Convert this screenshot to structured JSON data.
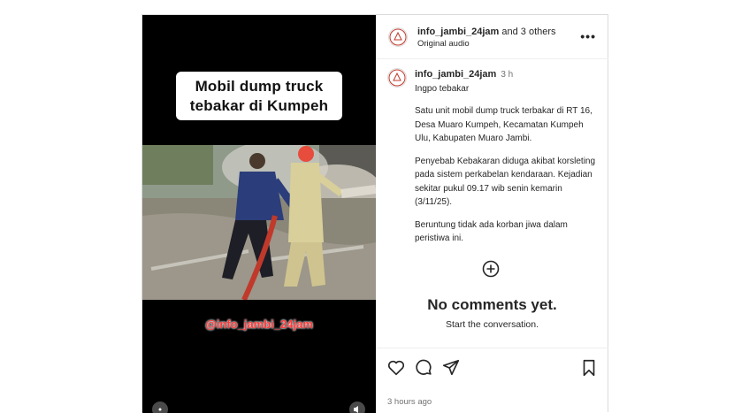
{
  "media": {
    "title_line1": "Mobil dump truck",
    "title_line2": "tebakar di Kumpeh",
    "watermark": "@info_jambi_24jam"
  },
  "header": {
    "username": "info_jambi_24jam",
    "others": " and 3 others",
    "audio": "Original audio",
    "more_icon": "more-horizontal-icon"
  },
  "caption": {
    "username": "info_jambi_24jam",
    "time": "3 h",
    "paragraphs": [
      "Ingpo tebakar",
      "Satu unit mobil dump truck  terbakar di RT 16, Desa Muaro Kumpeh, Kecamatan Kumpeh Ulu, Kabupaten Muaro Jambi.",
      "Penyebab Kebakaran diduga akibat korsleting pada sistem perkabelan kendaraan. Kejadian sekitar pukul 09.17 wib senin kemarin (3/11/25).",
      "Beruntung tidak ada korban jiwa dalam peristiwa ini."
    ]
  },
  "comments": {
    "empty_title": "No comments yet.",
    "empty_sub": "Start the conversation."
  },
  "footer": {
    "posted_ago": "3 hours ago"
  },
  "colors": {
    "border": "#dbdbdb",
    "text": "#262626",
    "muted": "#737373",
    "watermark": "#ff3b3b"
  }
}
